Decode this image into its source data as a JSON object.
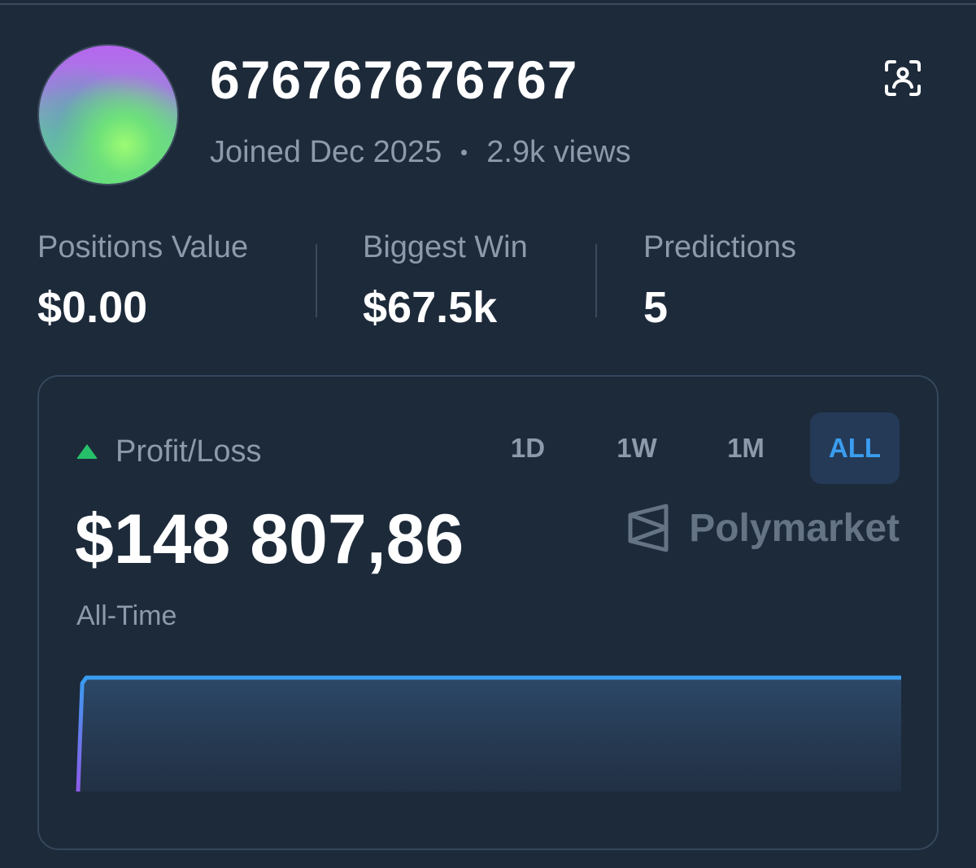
{
  "profile": {
    "username": "676767676767",
    "joined": "Joined Dec 2025",
    "views": "2.9k views"
  },
  "stats": [
    {
      "label": "Positions Value",
      "value": "$0.00"
    },
    {
      "label": "Biggest Win",
      "value": "$67.5k"
    },
    {
      "label": "Predictions",
      "value": "5"
    }
  ],
  "pnl": {
    "label": "Profit/Loss",
    "amount": "$148 807,86",
    "range_label": "All-Time",
    "tabs": [
      "1D",
      "1W",
      "1M",
      "ALL"
    ],
    "active_tab": "ALL",
    "brand": "Polymarket"
  },
  "colors": {
    "background": "#1d2a3a",
    "accent": "#3a9df0",
    "positive": "#27c06a",
    "muted": "#8d9aab"
  },
  "icons": {
    "header_action": "scan-profile-icon",
    "trend": "triangle-up-icon",
    "brand_logo": "polymarket-logo-icon"
  },
  "chart_data": {
    "type": "area",
    "x": [
      0,
      0.2,
      0.5,
      1,
      10,
      25,
      50,
      75,
      100
    ],
    "y": [
      0,
      40,
      95,
      100,
      100,
      100,
      100,
      100,
      100
    ],
    "title": "",
    "xlabel": "",
    "ylabel": "",
    "grid": false
  }
}
